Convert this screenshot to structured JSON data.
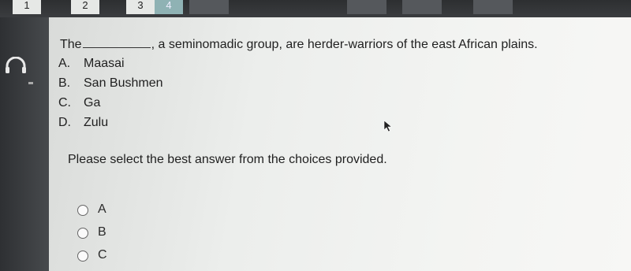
{
  "tabs": [
    "1",
    "2",
    "3",
    "4"
  ],
  "question": {
    "prefix": "The",
    "suffix": ", a seminomadic group, are herder-warriors of the east African plains."
  },
  "choices": [
    {
      "letter": "A.",
      "text": "Maasai"
    },
    {
      "letter": "B.",
      "text": "San Bushmen"
    },
    {
      "letter": "C.",
      "text": "Ga"
    },
    {
      "letter": "D.",
      "text": "Zulu"
    }
  ],
  "instruction": "Please select the best answer from the choices provided.",
  "answer_options": [
    "A",
    "B",
    "C"
  ],
  "colors": {
    "panel": "#eceeec",
    "background": "#3b3d40",
    "active_tab": "#8fb2b4"
  },
  "icons": {
    "audio": "headphones-icon",
    "pointer": "cursor-icon"
  }
}
